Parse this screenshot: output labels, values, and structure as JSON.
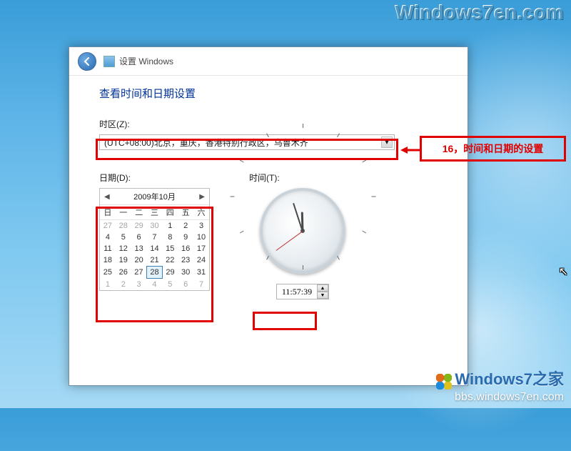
{
  "watermark_top": "Windows7en.com",
  "watermark_bottom": {
    "brand": "Windows7之家",
    "url": "bbs.windows7en.com"
  },
  "annotation": {
    "text": "16，时间和日期的设置"
  },
  "dialog": {
    "header_title": "设置 Windows",
    "main_title": "查看时间和日期设置",
    "timezone": {
      "label": "时区(Z):",
      "selected": "(UTC+08:00)北京，重庆，香港特别行政区，乌鲁木齐"
    },
    "date": {
      "label": "日期(D):",
      "month_title": "2009年10月",
      "weekdays": [
        "日",
        "一",
        "二",
        "三",
        "四",
        "五",
        "六"
      ],
      "weeks": [
        [
          {
            "n": 27,
            "dim": true
          },
          {
            "n": 28,
            "dim": true
          },
          {
            "n": 29,
            "dim": true
          },
          {
            "n": 30,
            "dim": true
          },
          {
            "n": 1
          },
          {
            "n": 2
          },
          {
            "n": 3
          }
        ],
        [
          {
            "n": 4
          },
          {
            "n": 5
          },
          {
            "n": 6
          },
          {
            "n": 7
          },
          {
            "n": 8
          },
          {
            "n": 9
          },
          {
            "n": 10
          }
        ],
        [
          {
            "n": 11
          },
          {
            "n": 12
          },
          {
            "n": 13
          },
          {
            "n": 14
          },
          {
            "n": 15
          },
          {
            "n": 16
          },
          {
            "n": 17
          }
        ],
        [
          {
            "n": 18
          },
          {
            "n": 19
          },
          {
            "n": 20
          },
          {
            "n": 21
          },
          {
            "n": 22
          },
          {
            "n": 23
          },
          {
            "n": 24
          }
        ],
        [
          {
            "n": 25
          },
          {
            "n": 26
          },
          {
            "n": 27
          },
          {
            "n": 28,
            "sel": true
          },
          {
            "n": 29
          },
          {
            "n": 30
          },
          {
            "n": 31
          }
        ],
        [
          {
            "n": 1,
            "dim": true
          },
          {
            "n": 2,
            "dim": true
          },
          {
            "n": 3,
            "dim": true
          },
          {
            "n": 4,
            "dim": true
          },
          {
            "n": 5,
            "dim": true
          },
          {
            "n": 6,
            "dim": true
          },
          {
            "n": 7,
            "dim": true
          }
        ]
      ]
    },
    "time": {
      "label": "时间(T):",
      "value": "11:57:39",
      "hours": 11,
      "minutes": 57,
      "seconds": 39
    }
  }
}
